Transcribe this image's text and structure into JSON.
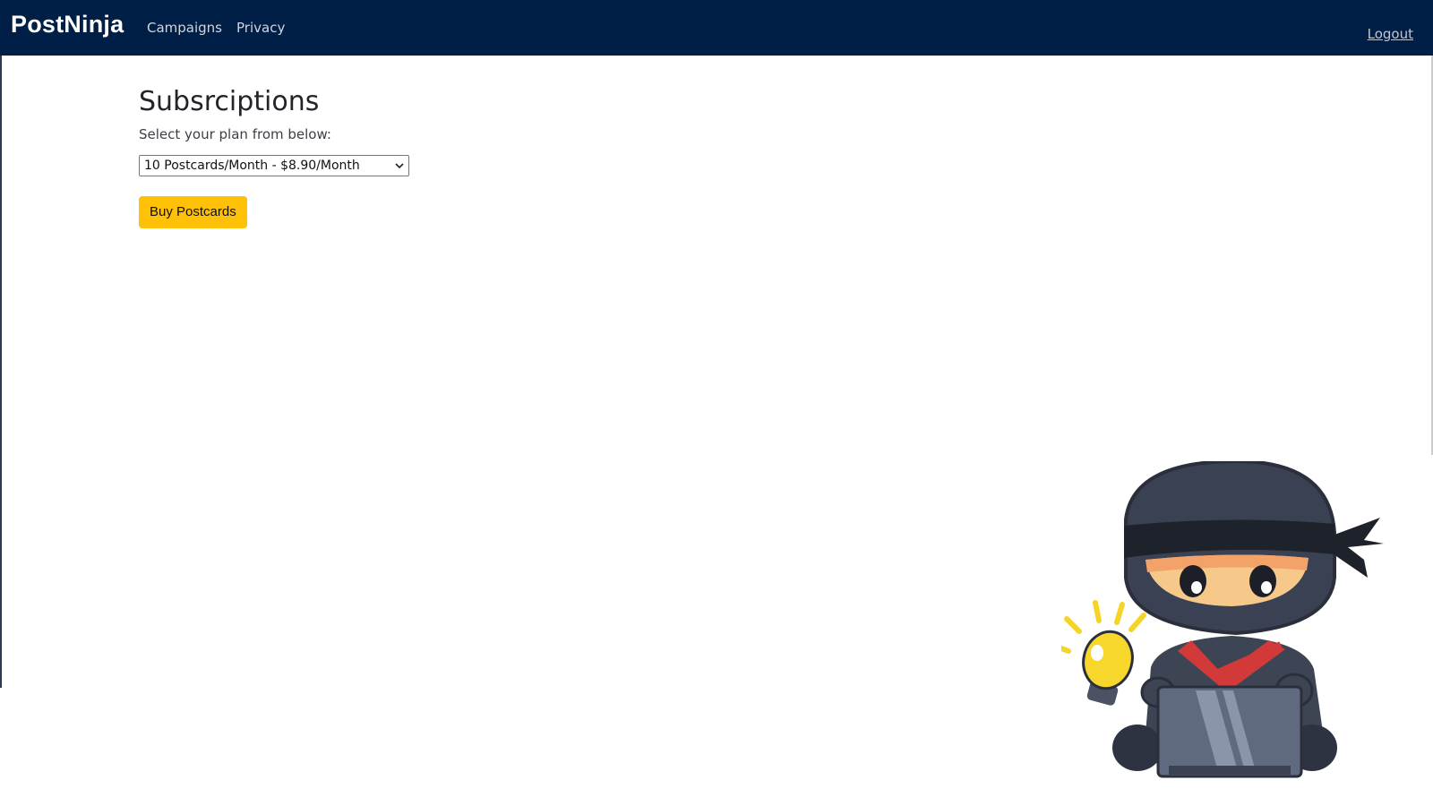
{
  "navbar": {
    "brand": "PostNinja",
    "links": [
      "Campaigns",
      "Privacy"
    ],
    "logout": "Logout"
  },
  "main": {
    "title": "Subsrciptions",
    "subtitle": "Select your plan from below:",
    "plan_select": {
      "selected": "10 Postcards/Month - $8.90/Month"
    },
    "buy_button": "Buy Postcards"
  },
  "colors": {
    "navbar_bg": "#001f47",
    "button_bg": "#ffc107"
  },
  "icons": {
    "dropdown": "chevron-down-icon",
    "illustration": "ninja-laptop-lightbulb-illustration"
  }
}
